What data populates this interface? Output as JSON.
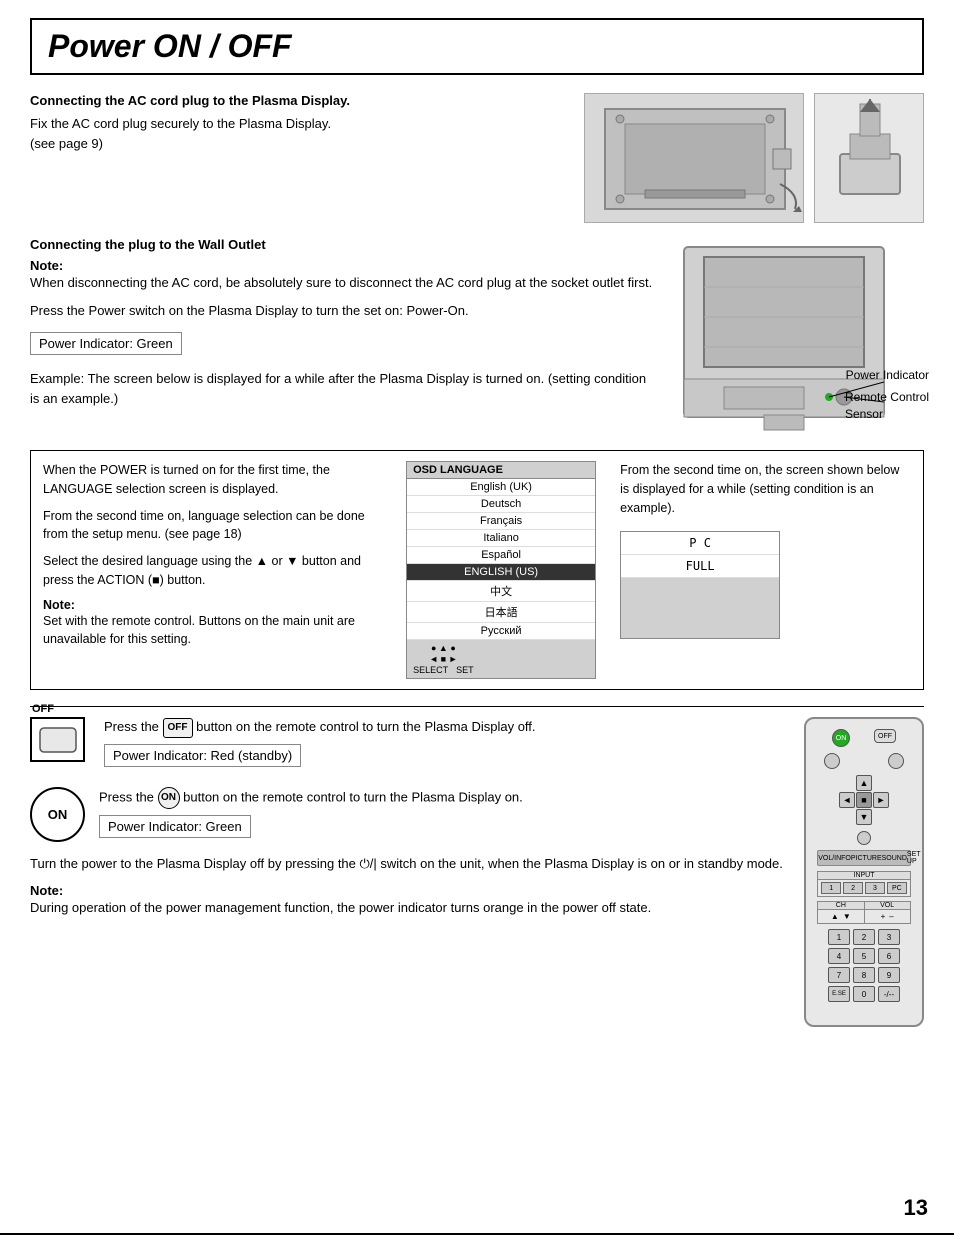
{
  "title": "Power ON / OFF",
  "section1": {
    "heading": "Connecting the AC cord plug to the Plasma Display.",
    "text": "Fix the AC cord plug securely to the Plasma Display.\n(see page 9)"
  },
  "section2": {
    "heading": "Connecting the plug to the Wall Outlet",
    "note_label": "Note:",
    "note_text": "When disconnecting the AC cord, be absolutely sure to disconnect the AC cord plug at the socket outlet first.",
    "press_text": "Press the Power switch on the Plasma Display to turn the set on: Power-On.",
    "indicator_green": "Power Indicator: Green",
    "example_text": "Example: The screen below is displayed for a while after the Plasma Display is turned on. (setting condition is an example.)",
    "power_indicator_label": "Power Indicator",
    "remote_sensor_label": "Remote Control\nSensor"
  },
  "infobox": {
    "left_text": "When the POWER is turned on for the first time, the LANGUAGE selection screen is displayed.\n\nFrom the second time on, language selection can be done from the setup menu. (see page 18)\n\nSelect the desired language using the ▲ or ▼ button and press the ACTION (■) button.",
    "note_label": "Note:",
    "note_text": "Set with the remote control. Buttons on the main unit are unavailable for this setting.",
    "right_text": "From the second time on, the screen shown below is displayed for a while (setting condition is an example).",
    "osd": {
      "header": "OSD LANGUAGE",
      "items": [
        "English (UK)",
        "Deutsch",
        "Français",
        "Italiano",
        "Español",
        "ENGLISH (US)",
        "中文",
        "日本語",
        "Русский"
      ],
      "selected_index": 5,
      "footer": "● ▲ ●\n◄ ■ ►\nSELECT  SET"
    },
    "pc_box": {
      "items": [
        "P C",
        "FULL"
      ]
    }
  },
  "off_section": {
    "off_label": "OFF",
    "off_btn_label": "OFF",
    "off_text": "Press the",
    "off_text2": "button on the remote control to turn the Plasma Display off.",
    "indicator_red": "Power Indicator: Red (standby)",
    "on_label": "ON",
    "on_text": "Press the",
    "on_text2": "button on the remote control to turn the Plasma Display on.",
    "indicator_green": "Power Indicator: Green",
    "turn_off_text": "Turn the power to the Plasma Display off by pressing the ⏻/| switch on the unit, when the Plasma Display is on or in standby mode.",
    "note2_label": "Note:",
    "note2_text": "During operation of the power management function, the power indicator turns orange in the power off state."
  },
  "page_number": "13"
}
